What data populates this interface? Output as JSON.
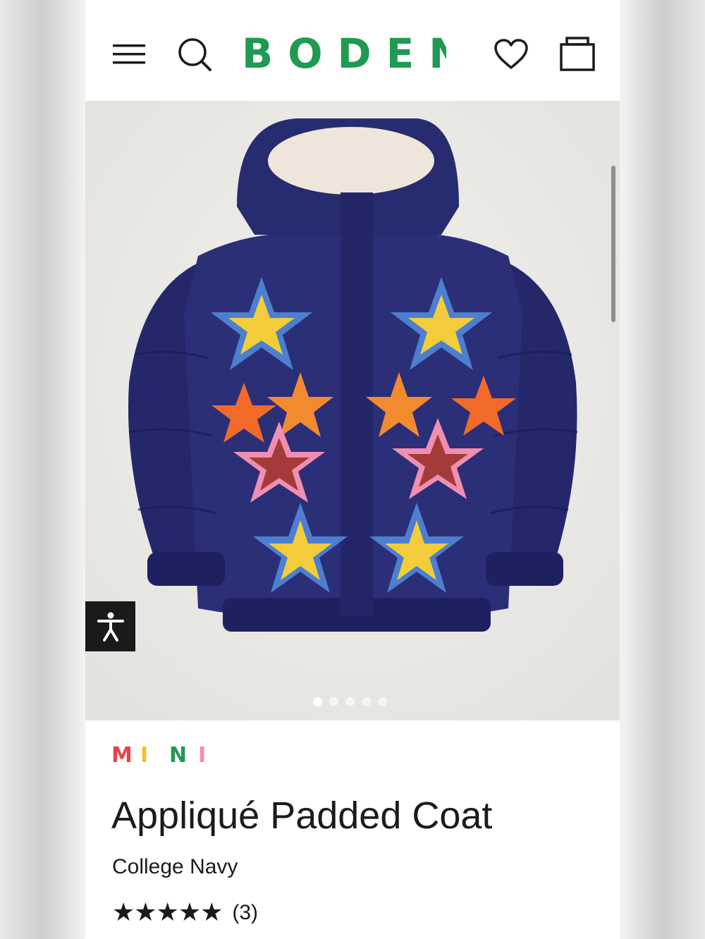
{
  "header": {
    "menu_icon": "hamburger-menu-icon",
    "search_icon": "search-icon",
    "logo_text": "BODEN",
    "wishlist_icon": "heart-icon",
    "bag_icon": "shopping-bag-icon",
    "logo_color": "#1f9a52"
  },
  "gallery": {
    "image_subject": "navy padded coat with star appliqués",
    "slide_count": 5,
    "active_slide": 1,
    "accessibility_icon": "accessibility-person-icon"
  },
  "product": {
    "brand_letters": [
      {
        "letter": "M",
        "color": "#e8424a"
      },
      {
        "letter": "I",
        "color": "#f2c12e"
      },
      {
        "letter": "N",
        "color": "#1f9a52"
      },
      {
        "letter": "I",
        "color": "#f08fb0"
      }
    ],
    "title": "Appliqué Padded Coat",
    "colour": "College Navy",
    "rating_stars": "★★★★★",
    "rating_value": 5,
    "review_count": "(3)"
  }
}
